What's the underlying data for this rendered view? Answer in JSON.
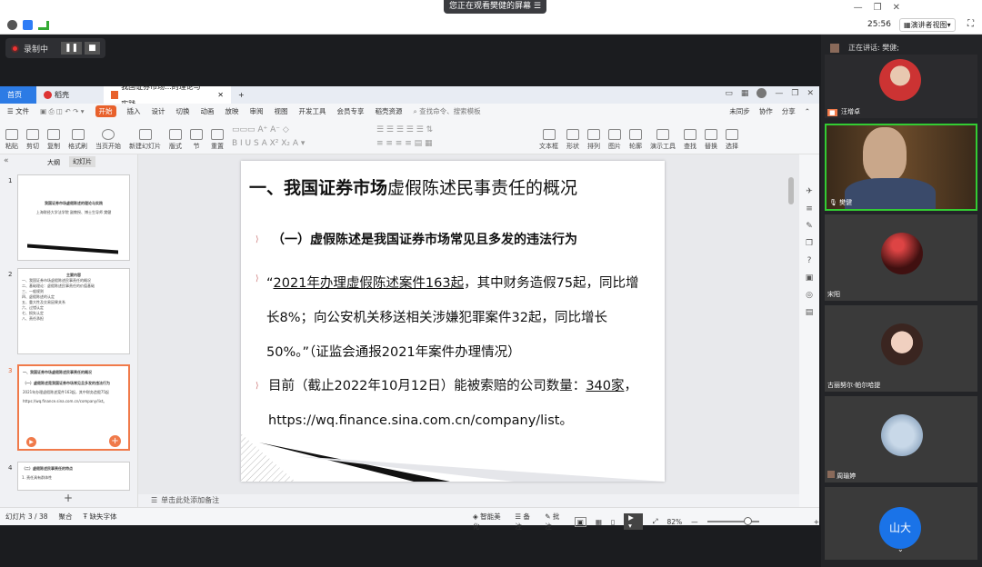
{
  "meeting": {
    "share_banner": "您正在观看樊健的屏幕",
    "time": "25:56",
    "view_mode": "演讲者视图",
    "speaking_label": "正在讲话: 樊健;",
    "recording_label": "录制中"
  },
  "ppt": {
    "tabs": [
      {
        "label": "首页"
      },
      {
        "label": "稻壳"
      },
      {
        "label": "我国证券市场...的理论与实践"
      }
    ],
    "menu": [
      "文件",
      "开始",
      "插入",
      "设计",
      "切换",
      "动画",
      "放映",
      "审阅",
      "视图",
      "开发工具",
      "会员专享",
      "稻壳资源"
    ],
    "search_placeholder": "查找命令、搜索模板",
    "menu_right": [
      "未同步",
      "协作",
      "分享"
    ],
    "ribbon": [
      "粘贴",
      "剪切",
      "复制",
      "格式刷",
      "当页开始",
      "新建幻灯片",
      "版式",
      "节",
      "重置",
      "文本框",
      "形状",
      "排列",
      "图片",
      "轮廓",
      "演示工具",
      "查找",
      "替换",
      "选择"
    ],
    "pane_tabs": [
      "大纲",
      "幻灯片"
    ],
    "thumbs": [
      {
        "num": "1",
        "title": "我国证券市场虚假陈述的理论与实践",
        "sub": "上海财经大学法学院 副教授、博士生导师 樊健"
      },
      {
        "num": "2",
        "title": "主要内容",
        "lines": [
          "一、我国证券市场虚假陈述民事责任的概况",
          "二、基础理论：虚假陈述民事责任的价值基础",
          "三、一般规则",
          "四、虚假陈述的认定",
          "五、重大性及交易因果关系",
          "六、过错认定",
          "七、损失认定",
          "八、责任承担"
        ]
      },
      {
        "num": "3",
        "title": "一、我国证券市场虚假陈述民事责任的概况",
        "lines": [
          "（一）虚假陈述是我国证券市场常见且多发的违法行为",
          "2021年办理虚假陈述案件163起，其中财务造假75起",
          "https://wq.finance.sina.com.cn/company/list。"
        ]
      },
      {
        "num": "4",
        "title": "（二）虚假陈述民事责任的特点",
        "lines": [
          "1. 责任具有群体性"
        ]
      }
    ],
    "slide": {
      "title_a": "一、我国证券市场",
      "title_b": "虚假陈述民事责任的概况",
      "heading": "（一）虚假陈述是我国证券市场常见且多发的违法行为",
      "quote_open": "“",
      "quote_link": "2021年办理虚假陈述案件163起",
      "quote_l1": "，其中财务造假75起，同比增",
      "quote_l2": "长8%；向公安机关移送相关涉嫌犯罪案件32起，同比增长",
      "quote_l3": "50%。”（证监会通报2021年案件办理情况）",
      "b2_pre": "目前（截止2022年10月12日）能被索赔的公司数量：",
      "b2_num": "340家",
      "b2_post": "，",
      "b2_url": "https://wq.finance.sina.com.cn/company/list。"
    },
    "notes_placeholder": "单击此处添加备注",
    "status": {
      "slide_info": "幻灯片 3 / 38",
      "theme": "聚合",
      "font_missing": "缺失字体",
      "beautify": "智能美化",
      "notes": "备注",
      "comments": "批注",
      "zoom": "82%"
    }
  },
  "participants": [
    {
      "name": "汪增卓"
    },
    {
      "name": "樊健"
    },
    {
      "name": "宋阳"
    },
    {
      "name": "古丽努尔·帕尔哈提"
    },
    {
      "name": "周瑜婷"
    },
    {
      "name": "山大",
      "avatar": "山大"
    }
  ],
  "colors": {
    "accent": "#f07a4a",
    "wps_red": "#d33",
    "meeting_blue": "#1a73e8"
  }
}
